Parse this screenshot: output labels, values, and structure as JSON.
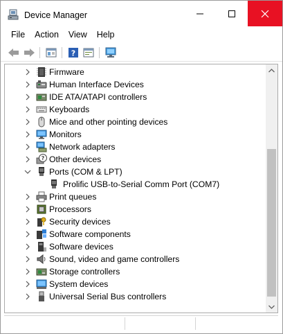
{
  "window": {
    "title": "Device Manager"
  },
  "menu": {
    "items": [
      "File",
      "Action",
      "View",
      "Help"
    ]
  },
  "toolbar": {
    "buttons": [
      "back-arrow-icon",
      "forward-arrow-icon",
      "properties-icon",
      "help-icon",
      "update-driver-icon",
      "monitor-scan-icon"
    ]
  },
  "tree": {
    "items": [
      {
        "label": "Firmware",
        "icon": "firmware-chip-icon",
        "expanded": false
      },
      {
        "label": "Human Interface Devices",
        "icon": "hid-icon",
        "expanded": false
      },
      {
        "label": "IDE ATA/ATAPI controllers",
        "icon": "ide-controller-icon",
        "expanded": false
      },
      {
        "label": "Keyboards",
        "icon": "keyboard-icon",
        "expanded": false
      },
      {
        "label": "Mice and other pointing devices",
        "icon": "mouse-icon",
        "expanded": false
      },
      {
        "label": "Monitors",
        "icon": "monitor-icon",
        "expanded": false
      },
      {
        "label": "Network adapters",
        "icon": "network-adapter-icon",
        "expanded": false
      },
      {
        "label": "Other devices",
        "icon": "unknown-device-icon",
        "expanded": false
      },
      {
        "label": "Ports (COM & LPT)",
        "icon": "port-icon",
        "expanded": true
      },
      {
        "label": "Prolific USB-to-Serial Comm Port (COM7)",
        "icon": "port-icon",
        "child": true
      },
      {
        "label": "Print queues",
        "icon": "printer-icon",
        "expanded": false
      },
      {
        "label": "Processors",
        "icon": "processor-icon",
        "expanded": false
      },
      {
        "label": "Security devices",
        "icon": "security-key-icon",
        "expanded": false
      },
      {
        "label": "Software components",
        "icon": "software-component-icon",
        "expanded": false
      },
      {
        "label": "Software devices",
        "icon": "software-device-icon",
        "expanded": false
      },
      {
        "label": "Sound, video and game controllers",
        "icon": "speaker-icon",
        "expanded": false
      },
      {
        "label": "Storage controllers",
        "icon": "storage-controller-icon",
        "expanded": false
      },
      {
        "label": "System devices",
        "icon": "system-device-icon",
        "expanded": false
      },
      {
        "label": "Universal Serial Bus controllers",
        "icon": "usb-icon",
        "expanded": false
      }
    ]
  },
  "colors": {
    "close_button": "#e81123",
    "accent_blue": "#2f7fd6"
  }
}
